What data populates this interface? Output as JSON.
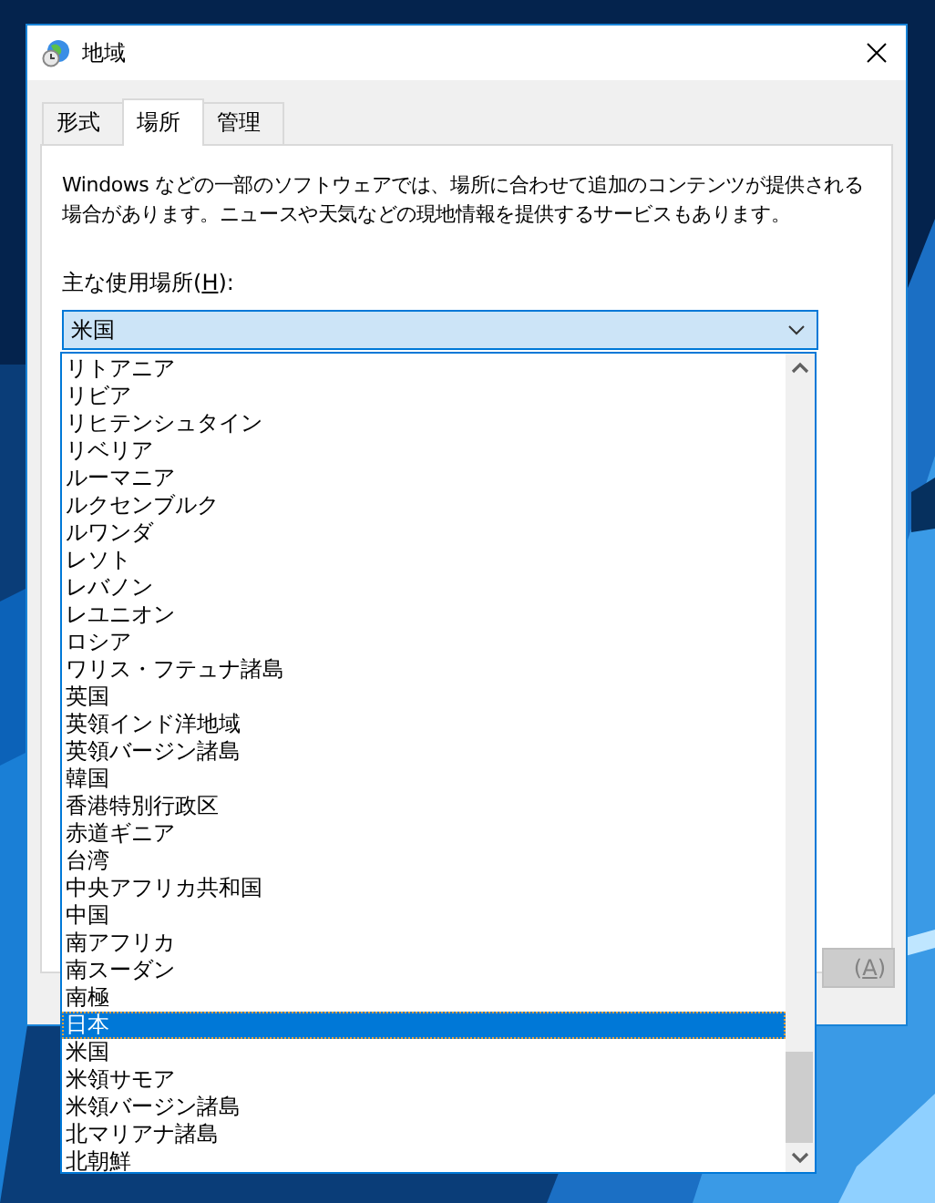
{
  "window": {
    "title": "地域"
  },
  "tabs": [
    {
      "label": "形式",
      "selected": false
    },
    {
      "label": "場所",
      "selected": true
    },
    {
      "label": "管理",
      "selected": false
    }
  ],
  "description": "Windows などの一部のソフトウェアでは、場所に合わせて追加のコンテンツが提供される場合があります。ニュースや天気などの現地情報を提供するサービスもあります。",
  "location_label": {
    "before": "主な使用場所(",
    "key": "H",
    "after": "):"
  },
  "location_combo": {
    "value": "米国",
    "expanded": true
  },
  "location_list": [
    {
      "label": "リトアニア",
      "selected": false
    },
    {
      "label": "リビア",
      "selected": false
    },
    {
      "label": "リヒテンシュタイン",
      "selected": false
    },
    {
      "label": "リベリア",
      "selected": false
    },
    {
      "label": "ルーマニア",
      "selected": false
    },
    {
      "label": "ルクセンブルク",
      "selected": false
    },
    {
      "label": "ルワンダ",
      "selected": false
    },
    {
      "label": "レソト",
      "selected": false
    },
    {
      "label": "レバノン",
      "selected": false
    },
    {
      "label": "レユニオン",
      "selected": false
    },
    {
      "label": "ロシア",
      "selected": false
    },
    {
      "label": "ワリス・フテュナ諸島",
      "selected": false
    },
    {
      "label": "英国",
      "selected": false
    },
    {
      "label": "英領インド洋地域",
      "selected": false
    },
    {
      "label": "英領バージン諸島",
      "selected": false
    },
    {
      "label": "韓国",
      "selected": false
    },
    {
      "label": "香港特別行政区",
      "selected": false
    },
    {
      "label": "赤道ギニア",
      "selected": false
    },
    {
      "label": "台湾",
      "selected": false
    },
    {
      "label": "中央アフリカ共和国",
      "selected": false
    },
    {
      "label": "中国",
      "selected": false
    },
    {
      "label": "南アフリカ",
      "selected": false
    },
    {
      "label": "南スーダン",
      "selected": false
    },
    {
      "label": "南極",
      "selected": false
    },
    {
      "label": "日本",
      "selected": true
    },
    {
      "label": "米国",
      "selected": false
    },
    {
      "label": "米領サモア",
      "selected": false
    },
    {
      "label": "米領バージン諸島",
      "selected": false
    },
    {
      "label": "北マリアナ諸島",
      "selected": false
    },
    {
      "label": "北朝鮮",
      "selected": false
    }
  ],
  "apply_button": {
    "before": "(",
    "key": "A",
    "after": ")",
    "disabled": true
  }
}
